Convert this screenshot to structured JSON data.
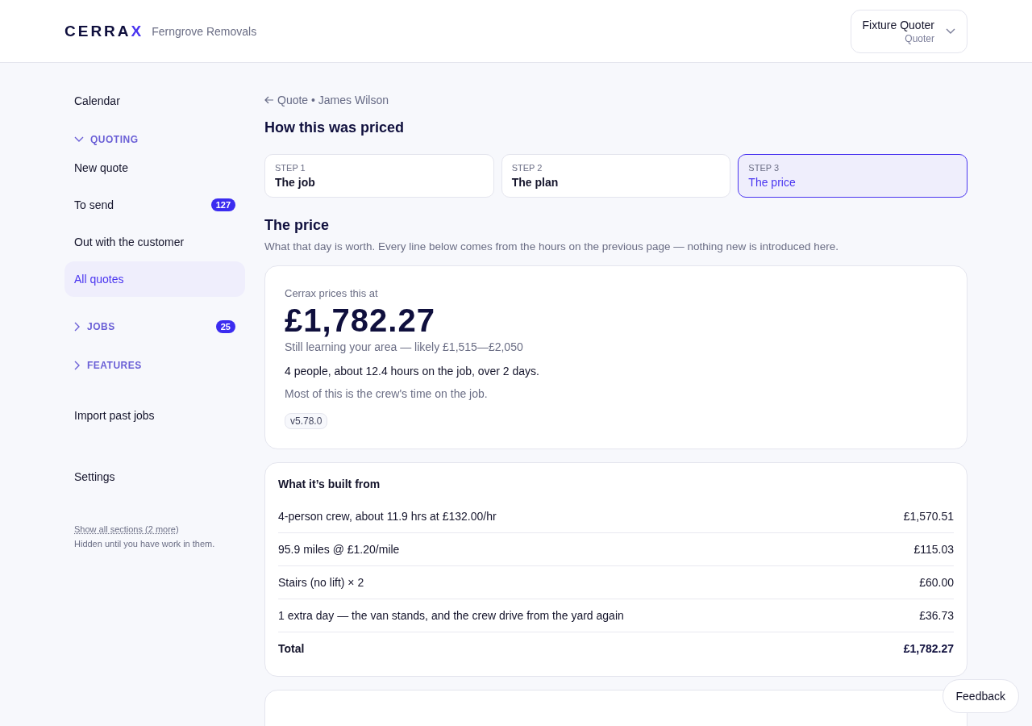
{
  "header": {
    "logo": "CERRA",
    "logo_accent": "X",
    "company": "Ferngrove Removals",
    "account": {
      "name": "Fixture Quoter",
      "role": "Quoter"
    }
  },
  "sidebar": {
    "items": [
      {
        "kind": "link",
        "label": "Calendar",
        "selected": false
      },
      {
        "kind": "section",
        "label": "QUOTING",
        "expanded": true,
        "children": [
          {
            "label": "New quote",
            "selected": false
          },
          {
            "label": "To send",
            "selected": false,
            "badge": "127"
          },
          {
            "label": "Out with the customer",
            "selected": false
          },
          {
            "label": "All quotes",
            "selected": true
          }
        ]
      },
      {
        "kind": "section",
        "label": "JOBS",
        "expanded": false,
        "badge": "25"
      },
      {
        "kind": "section",
        "label": "FEATURES",
        "expanded": false
      },
      {
        "kind": "link",
        "label": "Import past jobs",
        "selected": false
      },
      {
        "kind": "link",
        "label": "Settings",
        "selected": false
      }
    ],
    "more_link": "Show all sections (2 more)",
    "more_note": "Hidden until you have work in them."
  },
  "breadcrumb": "Quote • James Wilson",
  "page_title": "How this was priced",
  "steps": [
    {
      "step": "STEP 1",
      "title": "The job",
      "selected": false
    },
    {
      "step": "STEP 2",
      "title": "The plan",
      "selected": false
    },
    {
      "step": "STEP 3",
      "title": "The price",
      "selected": true
    }
  ],
  "section": {
    "title": "The price",
    "subtitle": "What that day is worth. Every line below comes from the hours on the previous page — nothing new is introduced here."
  },
  "price_card": {
    "label": "Cerrax prices this at",
    "price": "£1,782.27",
    "range": "Still learning your area — likely £1,515—£2,050",
    "summary": "4 people, about 12.4 hours on the job, over 2 days.",
    "note": "Most of this is the crew's time on the job.",
    "version": "v5.78.0"
  },
  "breakdown": {
    "title": "What it’s built from",
    "rows": [
      {
        "kind": "line",
        "label": "4-person crew, about 11.9 hrs at £132.00/hr",
        "amount": "£1,570.51"
      },
      {
        "kind": "line",
        "label": "95.9 miles @ £1.20/mile",
        "amount": "£115.03"
      },
      {
        "kind": "line",
        "label": "Stairs (no lift) × 2",
        "amount": "£60.00"
      },
      {
        "kind": "line",
        "label": "1 extra day — the van stands, and the crew drive from the yard again",
        "amount": "£36.73"
      },
      {
        "kind": "total",
        "label": "Total",
        "amount": "£1,782.27"
      }
    ]
  },
  "feedback_button": "Feedback"
}
